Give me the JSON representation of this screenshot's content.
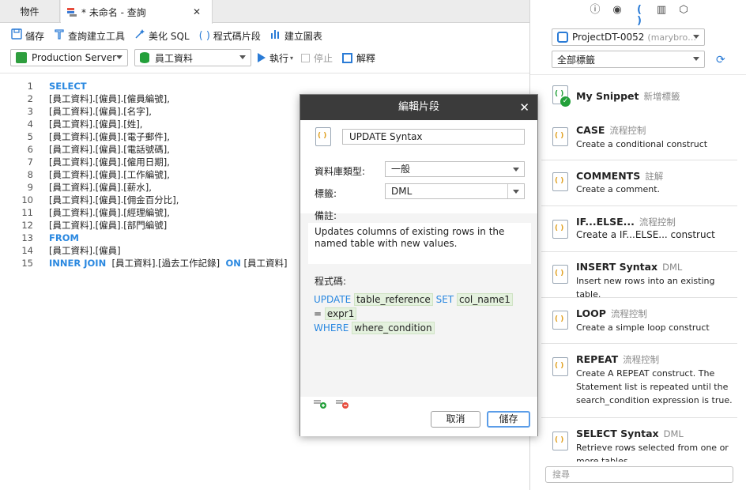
{
  "tabs": {
    "objects": "物件",
    "query": "* 未命名 - 查詢",
    "close": "✕"
  },
  "toolbar": {
    "save": "儲存",
    "query_builder": "查詢建立工具",
    "beautify": "美化 SQL",
    "snippet": "程式碼片段",
    "chart": "建立圖表",
    "server": "Production Server",
    "database": "員工資料",
    "run": "執行",
    "stop": "停止",
    "explain": "解釋"
  },
  "editor": {
    "lines": [
      {
        "n": "1",
        "kw": "SELECT",
        "text": ""
      },
      {
        "n": "2",
        "kw": "",
        "text": "[員工資料].[僱員].[僱員編號],"
      },
      {
        "n": "3",
        "kw": "",
        "text": "[員工資料].[僱員].[名字],"
      },
      {
        "n": "4",
        "kw": "",
        "text": "[員工資料].[僱員].[姓],"
      },
      {
        "n": "5",
        "kw": "",
        "text": "[員工資料].[僱員].[電子郵件],"
      },
      {
        "n": "6",
        "kw": "",
        "text": "[員工資料].[僱員].[電話號碼],"
      },
      {
        "n": "7",
        "kw": "",
        "text": "[員工資料].[僱員].[僱用日期],"
      },
      {
        "n": "8",
        "kw": "",
        "text": "[員工資料].[僱員].[工作編號],"
      },
      {
        "n": "9",
        "kw": "",
        "text": "[員工資料].[僱員].[薪水],"
      },
      {
        "n": "10",
        "kw": "",
        "text": "[員工資料].[僱員].[佣金百分比],"
      },
      {
        "n": "11",
        "kw": "",
        "text": "[員工資料].[僱員].[經理編號],"
      },
      {
        "n": "12",
        "kw": "",
        "text": "[員工資料].[僱員].[部門編號]"
      },
      {
        "n": "13",
        "kw": "FROM",
        "text": ""
      },
      {
        "n": "14",
        "kw": "",
        "text": "[員工資料].[僱員]"
      },
      {
        "n": "15",
        "kw": "INNER JOIN",
        "text": "[員工資料].[過去工作記錄]",
        "kw2": "ON",
        "text2": "[員工資料]"
      }
    ]
  },
  "right_panel": {
    "project": "ProjectDT-0052",
    "project_owner": "(marybro…",
    "tag_filter": "全部標籤",
    "search_placeholder": "搜尋",
    "snippets": [
      {
        "title": "My Snippet",
        "tag": "新增標籤",
        "desc": ""
      },
      {
        "title": "CASE",
        "tag": "流程控制",
        "desc": "Create a conditional construct"
      },
      {
        "title": "COMMENTS",
        "tag": "註解",
        "desc": "Create a comment."
      },
      {
        "title": "IF...ELSE...",
        "tag": "流程控制",
        "desc": "Create a IF...ELSE... construct"
      },
      {
        "title": "INSERT Syntax",
        "tag": "DML",
        "desc": "Insert new rows into an existing table."
      },
      {
        "title": "LOOP",
        "tag": "流程控制",
        "desc": "Create a simple loop construct"
      },
      {
        "title": "REPEAT",
        "tag": "流程控制",
        "desc": "Create A REPEAT construct. The Statement list is repeated until the search_condition expression is true."
      },
      {
        "title": "SELECT Syntax",
        "tag": "DML",
        "desc": "Retrieve rows selected from one or more tables."
      }
    ]
  },
  "dialog": {
    "title": "編輯片段",
    "name": "UPDATE Syntax",
    "db_type_label": "資料庫類型:",
    "db_type": "一般",
    "tag_label": "標籤:",
    "tag": "DML",
    "notes_label": "備註:",
    "notes": "Updates columns of existing rows in the named table with new values.",
    "code_label": "程式碼:",
    "code": {
      "k1": "UPDATE",
      "p1": "table_reference",
      "k2": "SET",
      "p2": "col_name1",
      "eq": "=",
      "p3": "expr1",
      "k3": "WHERE",
      "p4": "where_condition"
    },
    "cancel": "取消",
    "save": "儲存"
  }
}
